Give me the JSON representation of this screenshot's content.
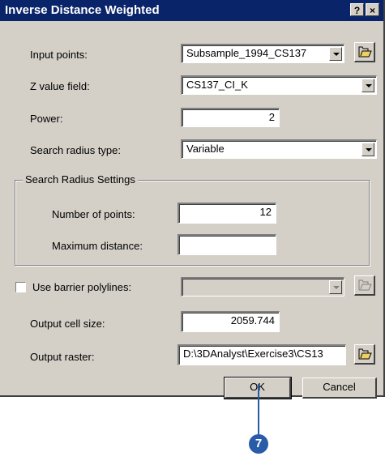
{
  "window": {
    "title": "Inverse Distance Weighted",
    "help_label": "?",
    "close_label": "×"
  },
  "fields": {
    "input_points": {
      "label": "Input points:",
      "value": "Subsample_1994_CS137"
    },
    "z_value": {
      "label": "Z value field:",
      "value": "CS137_CI_K"
    },
    "power": {
      "label": "Power:",
      "value": "2"
    },
    "search_radius_type": {
      "label": "Search radius type:",
      "value": "Variable"
    },
    "search_settings": {
      "title": "Search Radius Settings",
      "num_points": {
        "label": "Number of points:",
        "value": "12"
      },
      "max_distance": {
        "label": "Maximum distance:",
        "value": ""
      }
    },
    "barrier": {
      "label": "Use barrier polylines:",
      "checked": false,
      "value": ""
    },
    "cell_size": {
      "label": "Output cell size:",
      "value": "2059.744"
    },
    "output_raster": {
      "label": "Output raster:",
      "value": "D:\\3DAnalyst\\Exercise3\\CS13"
    }
  },
  "buttons": {
    "ok": "OK",
    "cancel": "Cancel"
  },
  "callout": {
    "number": "7",
    "color": "#2a5ba8"
  },
  "icons": [
    "help-icon",
    "close-icon",
    "folder-open-icon",
    "dropdown-arrow-icon",
    "checkbox-icon"
  ]
}
